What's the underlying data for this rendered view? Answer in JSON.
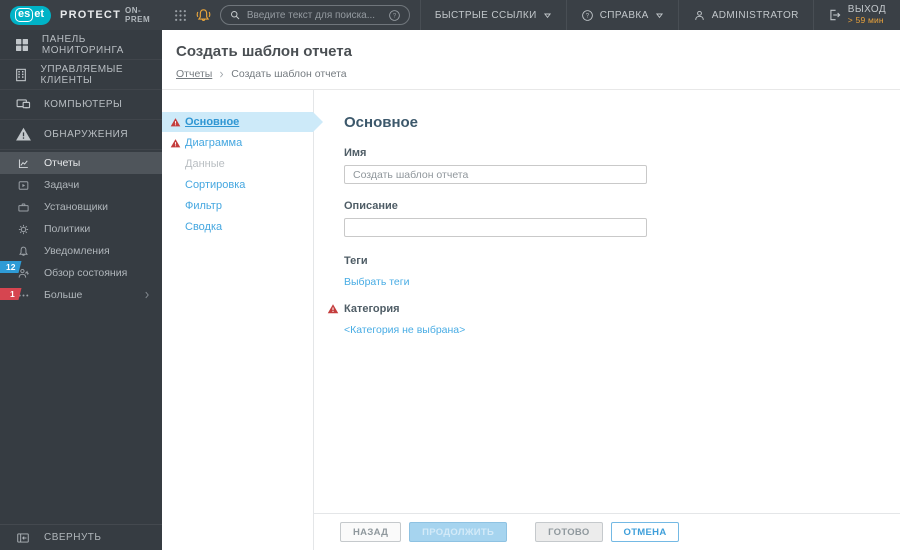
{
  "colors": {
    "brand_teal": "#00b3c7",
    "topbar_bg": "#3a4046",
    "sidebar_bg": "#363c42",
    "accent_blue": "#3f9fda",
    "warning_red": "#c43d3d",
    "badge_blue": "#2e9bd6",
    "badge_red": "#d64550",
    "session_amber": "#e9a23b",
    "selected_step_bg": "#cdeaf9"
  },
  "topbar": {
    "logo_es": "es",
    "logo_et": "et",
    "product": "PROTECT",
    "edition": "ON-PREM",
    "search_placeholder": "Введите текст для поиска...",
    "quick_links_label": "БЫСТРЫЕ ССЫЛКИ",
    "help_label": "СПРАВКА",
    "user_label": "ADMINISTRATOR",
    "logout_label": "ВЫХОД",
    "session_timer": "> 59 мин"
  },
  "sidebar": {
    "primary": [
      {
        "label": "ПАНЕЛЬ МОНИТОРИНГА",
        "icon": "dashboard-icon"
      },
      {
        "label": "УПРАВЛЯЕМЫЕ КЛИЕНТЫ",
        "icon": "managed-clients-icon"
      },
      {
        "label": "КОМПЬЮТЕРЫ",
        "icon": "computers-icon"
      },
      {
        "label": "ОБНАРУЖЕНИЯ",
        "icon": "detections-icon"
      }
    ],
    "secondary": [
      {
        "label": "Отчеты",
        "icon": "reports-icon",
        "selected": true
      },
      {
        "label": "Задачи",
        "icon": "tasks-icon"
      },
      {
        "label": "Установщики",
        "icon": "installers-icon"
      },
      {
        "label": "Политики",
        "icon": "policies-icon"
      },
      {
        "label": "Уведомления",
        "icon": "notifications-icon"
      },
      {
        "label": "Обзор состояния",
        "icon": "status-overview-icon"
      },
      {
        "label": "Больше",
        "icon": "more-icon",
        "has_submenu": true
      }
    ],
    "badge_blue": "12",
    "badge_red": "1",
    "collapse_label": "СВЕРНУТЬ"
  },
  "header": {
    "title": "Создать шаблон отчета",
    "breadcrumb_root": "Отчеты",
    "breadcrumb_current": "Создать шаблон отчета"
  },
  "wizard": {
    "steps": [
      {
        "label": "Основное",
        "selected": true,
        "warning": true
      },
      {
        "label": "Диаграмма",
        "warning": true
      },
      {
        "label": "Данные",
        "disabled": true
      },
      {
        "label": "Сортировка"
      },
      {
        "label": "Фильтр"
      },
      {
        "label": "Сводка"
      }
    ]
  },
  "form": {
    "heading": "Основное",
    "name_label": "Имя",
    "name_value": "Создать шаблон отчета",
    "description_label": "Описание",
    "description_value": "",
    "tags_label": "Теги",
    "tags_link": "Выбрать теги",
    "category_label": "Категория",
    "category_link": "<Категория не выбрана>"
  },
  "footer": {
    "back": "НАЗАД",
    "continue": "ПРОДОЛЖИТЬ",
    "finish": "ГОТОВО",
    "cancel": "ОТМЕНА"
  }
}
